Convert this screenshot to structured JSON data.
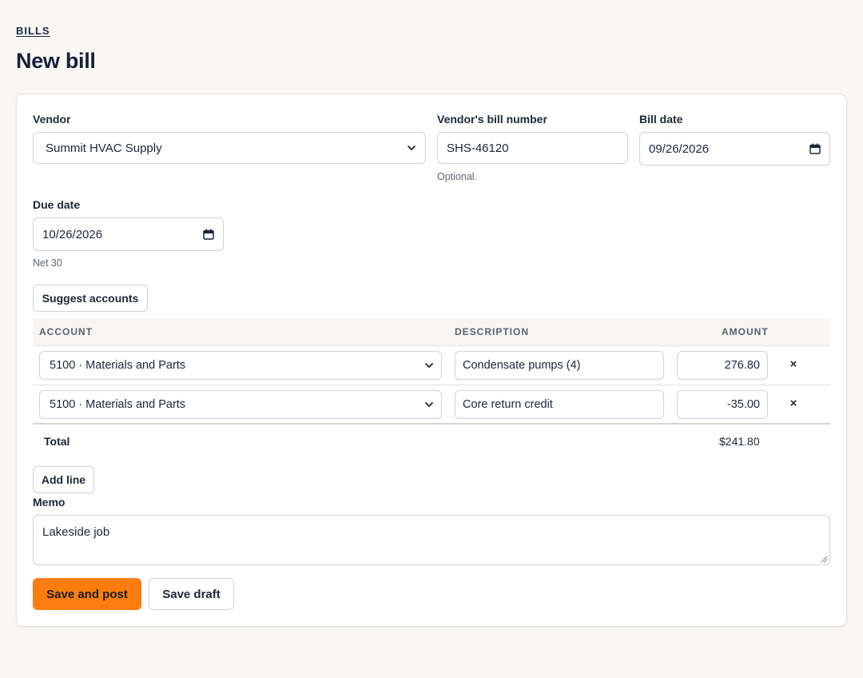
{
  "breadcrumb": "BILLS",
  "page_title": "New bill",
  "vendor": {
    "label": "Vendor",
    "value": "Summit HVAC Supply"
  },
  "bill_number": {
    "label": "Vendor's bill number",
    "value": "SHS-46120",
    "hint": "Optional."
  },
  "bill_date": {
    "label": "Bill date",
    "value": "09/26/2026"
  },
  "due_date": {
    "label": "Due date",
    "value": "10/26/2026",
    "hint": "Net 30"
  },
  "suggest_button": "Suggest accounts",
  "table": {
    "columns": [
      "ACCOUNT",
      "DESCRIPTION",
      "AMOUNT"
    ],
    "lines": [
      {
        "account": "5100 · Materials and Parts",
        "description": "Condensate pumps (4)",
        "amount": "276.80",
        "remove": "×"
      },
      {
        "account": "5100 · Materials and Parts",
        "description": "Core return credit",
        "amount": "-35.00",
        "remove": "×"
      }
    ],
    "total_label": "Total",
    "total_value": "$241.80"
  },
  "add_line_button": "Add line",
  "memo": {
    "label": "Memo",
    "value": "Lakeside job"
  },
  "actions": {
    "primary": "Save and post",
    "secondary": "Save draft"
  },
  "colors": {
    "accent": "#fb7d10",
    "page_bg": "#f8f7f4",
    "text": "#1e2638"
  },
  "icons": {
    "select": "chevron-down-icon",
    "date": "calendar-icon",
    "remove": "close-icon"
  }
}
